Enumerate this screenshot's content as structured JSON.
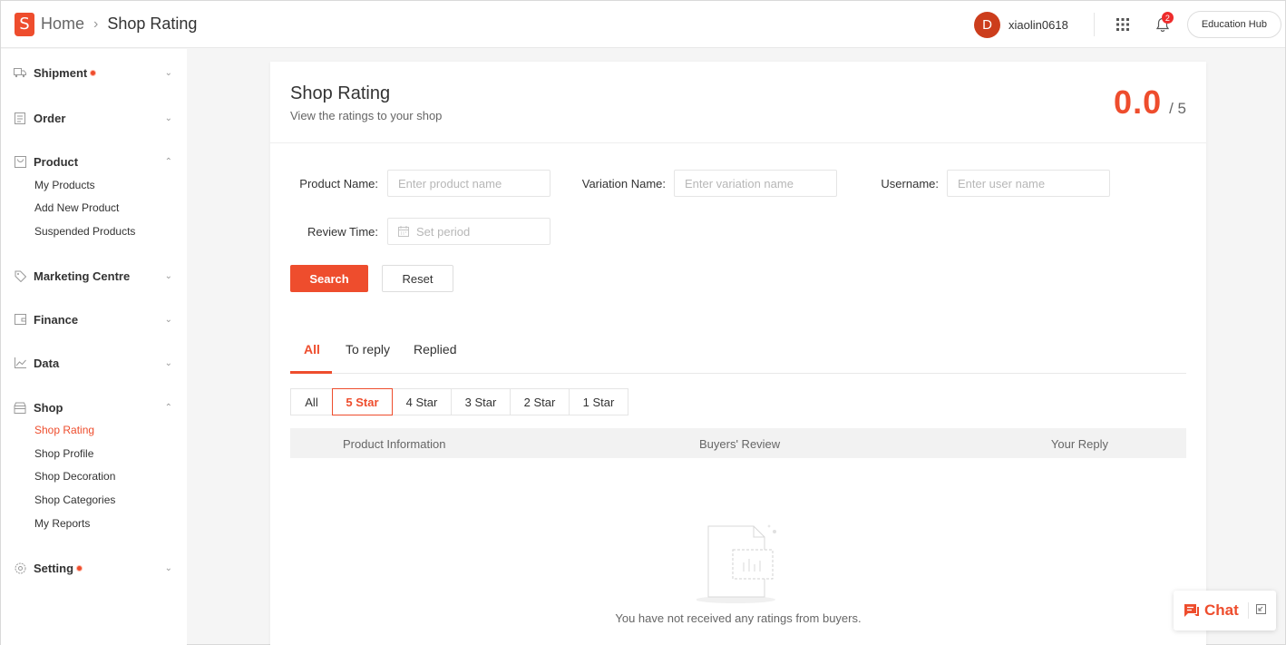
{
  "header": {
    "logo_letter": "S",
    "breadcrumb_home": "Home",
    "breadcrumb_sep": "›",
    "breadcrumb_current": "Shop Rating",
    "avatar_letter": "D",
    "username": "xiaolin0618",
    "notification_count": "2",
    "education_hub": "Education Hub"
  },
  "sidebar": {
    "shipment": "Shipment",
    "order": "Order",
    "product": "Product",
    "product_items": [
      "My Products",
      "Add New Product",
      "Suspended Products"
    ],
    "marketing": "Marketing Centre",
    "finance": "Finance",
    "data": "Data",
    "shop": "Shop",
    "shop_items": [
      "Shop Rating",
      "Shop Profile",
      "Shop Decoration",
      "Shop Categories",
      "My Reports"
    ],
    "setting": "Setting"
  },
  "main": {
    "title": "Shop Rating",
    "subtitle": "View the ratings to your shop",
    "score": "0.0",
    "score_max": "/ 5",
    "filters": {
      "product_label": "Product Name:",
      "product_placeholder": "Enter product name",
      "variation_label": "Variation Name:",
      "variation_placeholder": "Enter variation name",
      "username_label": "Username:",
      "username_placeholder": "Enter user name",
      "review_time_label": "Review Time:",
      "review_time_placeholder": "Set period"
    },
    "search_button": "Search",
    "reset_button": "Reset",
    "tabs": [
      "All",
      "To reply",
      "Replied"
    ],
    "star_filters": [
      "All",
      "5 Star",
      "4 Star",
      "3 Star",
      "2 Star",
      "1 Star"
    ],
    "table_headers": [
      "Product Information",
      "Buyers' Review",
      "Your Reply"
    ],
    "empty_message": "You have not received any ratings from buyers."
  },
  "chat": {
    "label": "Chat"
  },
  "colors": {
    "accent": "#ee4d2d"
  }
}
